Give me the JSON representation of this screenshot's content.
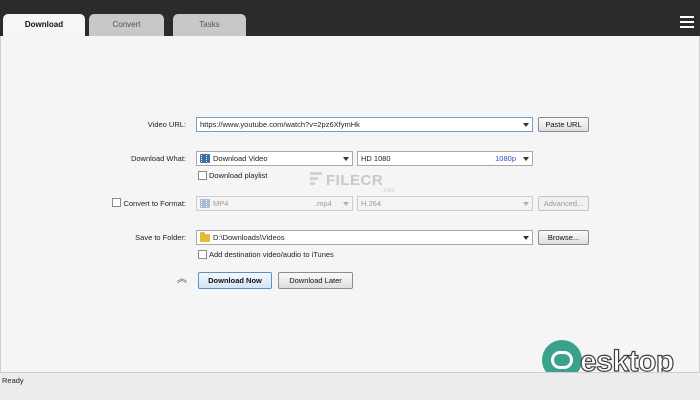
{
  "tabs": [
    {
      "label": "Download",
      "active": true
    },
    {
      "label": "Convert",
      "active": false
    },
    {
      "label": "Tasks",
      "active": false
    }
  ],
  "menu_icon": "hamburger-menu-icon",
  "form": {
    "video_url": {
      "label": "Video URL:",
      "value": "https://www.youtube.com/watch?v=2pz6XfymHk",
      "paste_button": "Paste URL"
    },
    "download_what": {
      "label": "Download What:",
      "type_value": "Download Video",
      "quality_value": "HD 1080",
      "resolution": "1080p",
      "playlist_checkbox_label": "Download playlist",
      "playlist_checked": false
    },
    "convert_to_format": {
      "label": "Convert to Format:",
      "checked": false,
      "format_value": "MP4",
      "extension": ".mp4",
      "codec_value": "H.264",
      "advanced_button": "Advanced..."
    },
    "save_to_folder": {
      "label": "Save to Folder:",
      "value": "D:\\Downloads\\Videos",
      "browse_button": "Browse...",
      "itunes_checkbox_label": "Add destination video/audio to iTunes",
      "itunes_checked": false
    },
    "actions": {
      "download_now": "Download Now",
      "download_later": "Download Later"
    }
  },
  "watermarks": {
    "filecr": "FILECR",
    "filecr_sub": ".com",
    "desktop": "esktop"
  },
  "status": {
    "text": "Ready"
  },
  "colors": {
    "title_bar": "#2b2b2b",
    "active_tab": "#f6f6f6",
    "inactive_tab": "#c8c8c8",
    "resolution_text": "#2b4ec7",
    "primary_button_border": "#5a8fc8",
    "desktop_logo": "#3aa18c"
  }
}
